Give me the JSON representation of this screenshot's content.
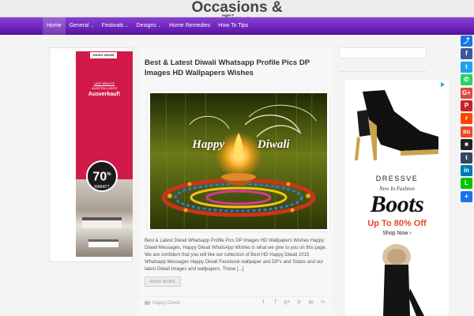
{
  "site": {
    "title_line1": "Occasions &",
    "title_line2": "Tips"
  },
  "nav": {
    "items": [
      {
        "label": "Home",
        "has_caret": false
      },
      {
        "label": "General",
        "has_caret": true
      },
      {
        "label": "Festivals",
        "has_caret": true
      },
      {
        "label": "Designs",
        "has_caret": true
      },
      {
        "label": "Home Remedies",
        "has_caret": false
      },
      {
        "label": "How To Tips",
        "has_caret": false
      }
    ],
    "caret": "⌄"
  },
  "ad_left": {
    "brand": "SWISS SENSE",
    "promo_line1": "LAST MINUTE",
    "promo_line2": "AUSSTELLUNGS",
    "promo_line3": "Ausverkauf!",
    "badge_number": "70",
    "badge_unit": "%",
    "badge_label": "RABATT"
  },
  "post": {
    "title": "Best & Latest Diwali Whatsapp Profile Pics DP Images HD Wallpapers Wishes",
    "image_text": "Happy Diwali",
    "excerpt": "Best & Latest Diwali Whatsapp Profile Pics DP Images HD Wallpapers Wishes Happy Diwali Messages, Happy Diwali WhatsApp Wishes is what we give to you on this page. We are confident that you will like our collection of Best HD Happy Diwali 2015 Whatsapp Messages Happy Diwali Facebook wallpaper and DP's and Status and our latest Diwali Images and wallpapers. These [...]",
    "read_more": "READ MORE",
    "category": "Happy Diwali",
    "share_icons": [
      "twitter-icon",
      "facebook-icon",
      "google-plus-icon",
      "pinterest-icon",
      "email-icon",
      "share-icon"
    ],
    "share_glyphs": [
      "t",
      "f",
      "g+",
      "p",
      "✉",
      "↷"
    ]
  },
  "ad_right": {
    "brand": "DRESSVE",
    "tagline": "New In Fashion",
    "headline": "Boots",
    "offer": "Up To 80% Off",
    "cta": "Shop Now ›"
  },
  "social_bar": [
    {
      "name": "share-icon",
      "glyph": "⤴",
      "color": "#1a73e8"
    },
    {
      "name": "facebook-icon",
      "glyph": "f",
      "color": "#3b5998"
    },
    {
      "name": "twitter-icon",
      "glyph": "t",
      "color": "#1da1f2"
    },
    {
      "name": "whatsapp-icon",
      "glyph": "✆",
      "color": "#25d366"
    },
    {
      "name": "google-plus-icon",
      "glyph": "G+",
      "color": "#dd4b39"
    },
    {
      "name": "pinterest-icon",
      "glyph": "P",
      "color": "#cb2027"
    },
    {
      "name": "reddit-icon",
      "glyph": "r",
      "color": "#ff4500"
    },
    {
      "name": "stumbleupon-icon",
      "glyph": "su",
      "color": "#eb4924"
    },
    {
      "name": "delicious-icon",
      "glyph": "■",
      "color": "#222222"
    },
    {
      "name": "tumblr-icon",
      "glyph": "t",
      "color": "#35465c"
    },
    {
      "name": "linkedin-icon",
      "glyph": "in",
      "color": "#0077b5"
    },
    {
      "name": "line-icon",
      "glyph": "L",
      "color": "#00c300"
    },
    {
      "name": "more-share-icon",
      "glyph": "+",
      "color": "#1a73e8"
    }
  ],
  "colors": {
    "nav_top": "#8a3fd4",
    "nav_bottom": "#5b14a8",
    "ad_left_bg": "#d21a4a",
    "offer": "#e8462e"
  }
}
